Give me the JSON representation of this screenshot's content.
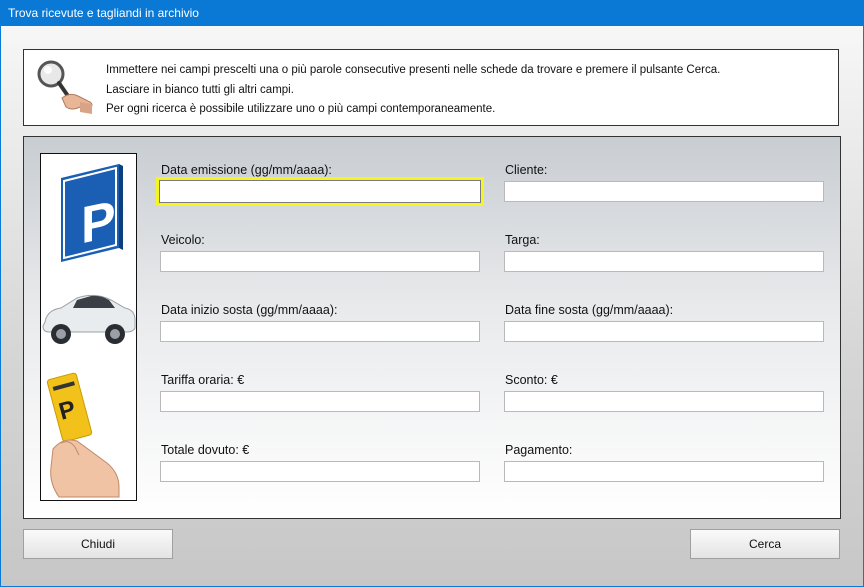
{
  "window": {
    "title": "Trova ricevute e tagliandi in archivio"
  },
  "info": {
    "line1": "Immettere nei campi prescelti una o più parole consecutive presenti nelle schede da trovare e premere il pulsante Cerca.",
    "line2": "Lasciare in bianco tutti gli altri campi.",
    "line3": "Per ogni ricerca è possibile utilizzare uno o più campi contemporaneamente."
  },
  "fields": {
    "data_emissione": {
      "label": "Data emissione (gg/mm/aaaa):",
      "value": ""
    },
    "cliente": {
      "label": "Cliente:",
      "value": ""
    },
    "veicolo": {
      "label": "Veicolo:",
      "value": ""
    },
    "targa": {
      "label": "Targa:",
      "value": ""
    },
    "data_inizio": {
      "label": "Data inizio sosta (gg/mm/aaaa):",
      "value": ""
    },
    "data_fine": {
      "label": "Data fine sosta (gg/mm/aaaa):",
      "value": ""
    },
    "tariffa": {
      "label": "Tariffa oraria: €",
      "value": ""
    },
    "sconto": {
      "label": "Sconto: €",
      "value": ""
    },
    "totale": {
      "label": "Totale dovuto: €",
      "value": ""
    },
    "pagamento": {
      "label": "Pagamento:",
      "value": ""
    }
  },
  "buttons": {
    "close": "Chiudi",
    "search": "Cerca"
  },
  "images": {
    "info_icon": "magnifier-hand-icon",
    "strip": [
      "parking-sign-icon",
      "car-icon",
      "parking-ticket-hand-icon"
    ]
  },
  "colors": {
    "titlebar": "#0a79d6",
    "focus_border": "#f5f526",
    "parking_blue": "#1a5fb4"
  }
}
